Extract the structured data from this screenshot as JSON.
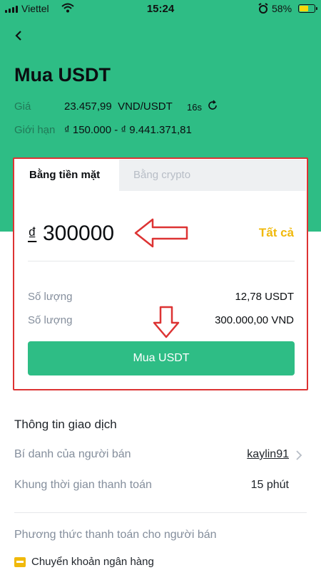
{
  "status_bar": {
    "carrier": "Viettel",
    "time": "15:24",
    "battery": "58%",
    "battery_level": 0.58,
    "icons": [
      "signal-icon",
      "wifi-icon",
      "alarm-icon",
      "battery-icon"
    ]
  },
  "header": {
    "back_icon": "chevron-left-icon",
    "title": "Mua USDT",
    "price_label": "Giá",
    "price_value": "23.457,99  VND/USDT",
    "timer": "16s",
    "refresh_icon": "refresh-icon",
    "limit_label": "Giới hạn",
    "limit_value": "₫ 150.000 - ₫ 9.441.371,81"
  },
  "card": {
    "tabs": [
      {
        "label": "Bằng tiền mặt",
        "active": true
      },
      {
        "label": "Bằng crypto",
        "active": false
      }
    ],
    "currency_symbol": "₫",
    "amount": "300000",
    "all_button": "Tất cả",
    "rows": [
      {
        "label": "Số lượng",
        "value": "12,78 USDT"
      },
      {
        "label": "Số lượng",
        "value": "300.000,00 VND"
      }
    ],
    "buy_button": "Mua USDT"
  },
  "transaction": {
    "section_title": "Thông tin giao dịch",
    "seller_label": "Bí danh của người bán",
    "seller_value": "kaylin91",
    "time_label": "Khung thời gian thanh toán",
    "time_value": "15 phút",
    "method_title": "Phương thức thanh toán cho người bán",
    "method_icon": "bank-card-icon",
    "method_label": "Chuyển khoản ngân hàng"
  },
  "colors": {
    "brand_green": "#2ebd85",
    "accent_yellow": "#f0b90b",
    "annotation_red": "#d33333"
  }
}
